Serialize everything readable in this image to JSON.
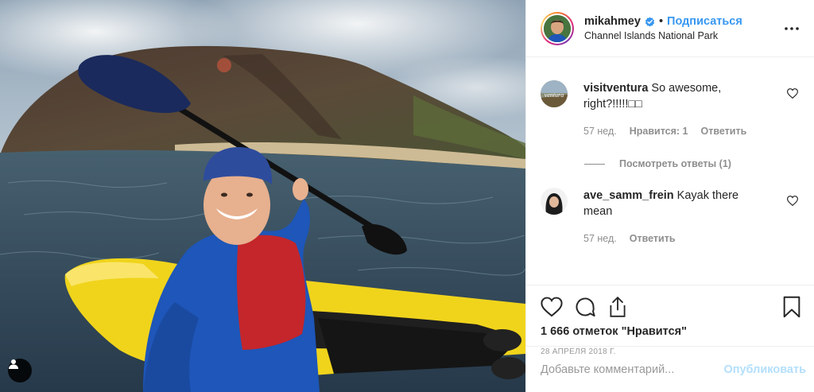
{
  "header": {
    "username": "mikahmey",
    "separator": "•",
    "follow_label": "Подписаться",
    "location": "Channel Islands National Park"
  },
  "comments": [
    {
      "username": "visitventura",
      "text": "So awesome, right?!!!!!□□",
      "time": "57 нед.",
      "likes_label": "Нравится: 1",
      "reply_label": "Ответить",
      "view_replies_label": "Посмотреть ответы (1)"
    },
    {
      "username": "ave_samm_frein",
      "text": "Kayak there mean",
      "time": "57 нед.",
      "reply_label": "Ответить"
    }
  ],
  "actions": {
    "likes_text": "1 666 отметок \"Нравится\"",
    "date": "28 АПРЕЛЯ 2018 Г."
  },
  "add_comment": {
    "placeholder": "Добавьте комментарий...",
    "post_label": "Опубликовать"
  },
  "colors": {
    "accent": "#3897f0",
    "verified": "#3897f0",
    "post_disabled": "#b2dffc"
  },
  "icons": [
    "user-tag-icon",
    "verified-icon",
    "more-options-icon",
    "heart-icon",
    "comment-icon",
    "share-icon",
    "bookmark-icon"
  ]
}
